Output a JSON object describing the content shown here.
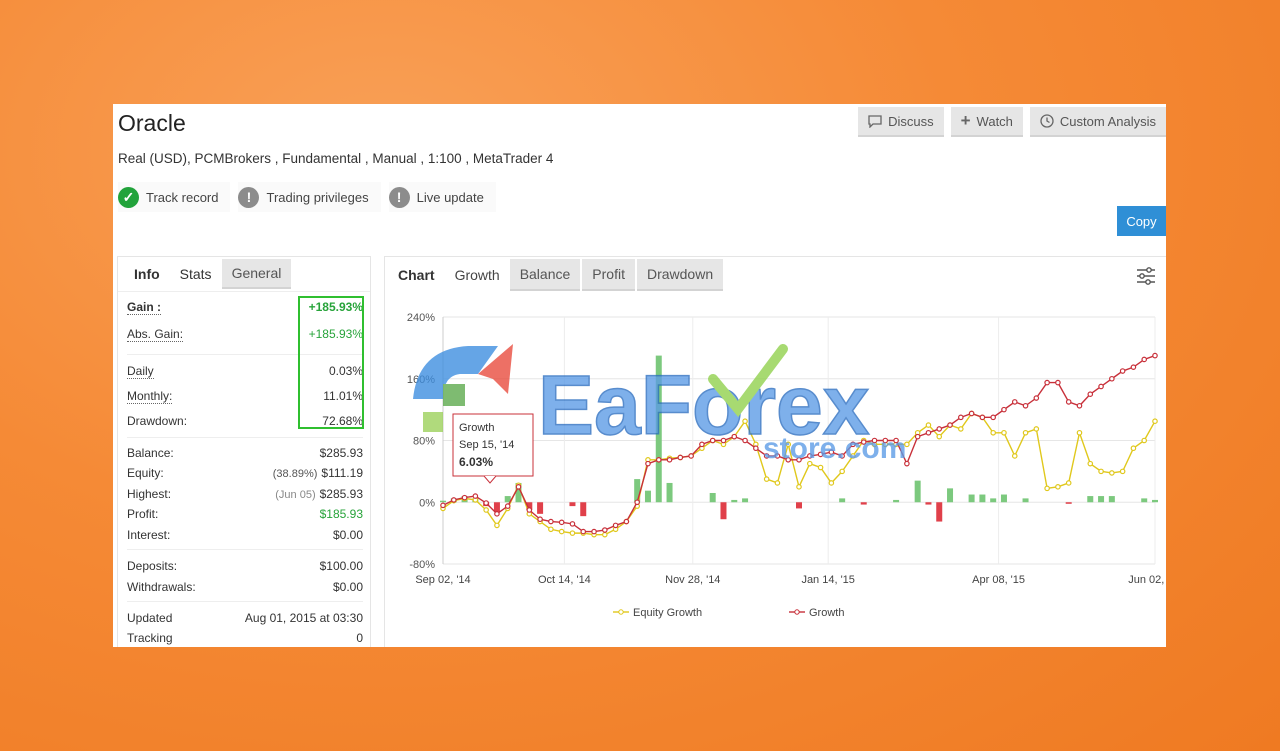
{
  "account": {
    "name": "Oracle",
    "details": "Real (USD), PCMBrokers , Fundamental , Manual , 1:100 , MetaTrader 4",
    "badges": [
      {
        "label": "Track record",
        "status": "ok",
        "icon": "check-icon"
      },
      {
        "label": "Trading privileges",
        "status": "unknown",
        "icon": "exclamation-icon"
      },
      {
        "label": "Live update",
        "status": "unknown",
        "icon": "exclamation-icon"
      }
    ]
  },
  "toolbar": {
    "discuss": "Discuss",
    "watch": "Watch",
    "custom_analysis": "Custom Analysis",
    "copy": "Copy"
  },
  "left_tabs": {
    "info": "Info",
    "stats": "Stats",
    "general": "General"
  },
  "stats": {
    "gain": {
      "label": "Gain :",
      "value": "+185.93%"
    },
    "abs_gain": {
      "label": "Abs. Gain:",
      "value": "+185.93%"
    },
    "daily": {
      "label": "Daily",
      "value": "0.03%"
    },
    "monthly": {
      "label": "Monthly:",
      "value": "11.01%"
    },
    "drawdown": {
      "label": "Drawdown:",
      "value": "72.68%"
    },
    "balance": {
      "label": "Balance:",
      "value": "$285.93"
    },
    "equity": {
      "label": "Equity:",
      "note": "(38.89%)",
      "value": "$111.19"
    },
    "highest": {
      "label": "Highest:",
      "note": "(Jun 05)",
      "value": "$285.93"
    },
    "profit": {
      "label": "Profit:",
      "value": "$185.93"
    },
    "interest": {
      "label": "Interest:",
      "value": "$0.00"
    },
    "deposits": {
      "label": "Deposits:",
      "value": "$100.00"
    },
    "withdrawals": {
      "label": "Withdrawals:",
      "value": "$0.00"
    },
    "updated": {
      "label": "Updated",
      "value": "Aug 01, 2015 at 03:30"
    },
    "tracking": {
      "label": "Tracking",
      "value": "0"
    }
  },
  "chart_tabs": {
    "chart": "Chart",
    "growth": "Growth",
    "balance": "Balance",
    "profit": "Profit",
    "drawdown": "Drawdown"
  },
  "watermark": {
    "brand": "EaForex",
    "sub": "store.com"
  },
  "tooltip": {
    "title": "Growth",
    "date": "Sep 15, '14",
    "value": "6.03%"
  },
  "colors": {
    "equity": "#e0c81c",
    "growth": "#c8303a",
    "bar_pos": "#7cc97e",
    "bar_neg": "#e0404a",
    "accent": "#2f8fd6"
  },
  "chart_data": {
    "type": "line",
    "ylim": [
      -80,
      240
    ],
    "yticks": [
      -80,
      0,
      80,
      160,
      240
    ],
    "ytick_labels": [
      "-80%",
      "0%",
      "80%",
      "160%",
      "240%"
    ],
    "xticks": [
      "Sep 02, '14",
      "Oct 14, '14",
      "Nov 28, '14",
      "Jan 14, '15",
      "Apr 08, '15",
      "Jun 02, '15"
    ],
    "legend_position": "bottom",
    "series": [
      {
        "name": "Equity Growth",
        "values": [
          -8,
          2,
          5,
          3,
          -10,
          -30,
          -8,
          22,
          -15,
          -25,
          -35,
          -38,
          -40,
          -40,
          -42,
          -42,
          -35,
          -25,
          -5,
          55,
          55,
          57,
          58,
          60,
          70,
          80,
          75,
          85,
          105,
          75,
          30,
          25,
          75,
          20,
          50,
          45,
          25,
          40,
          60,
          80,
          75,
          75,
          75,
          75,
          90,
          100,
          85,
          100,
          95,
          115,
          110,
          90,
          90,
          60,
          90,
          95,
          18,
          20,
          25,
          90,
          50,
          40,
          38,
          40,
          70,
          80,
          105
        ]
      },
      {
        "name": "Growth",
        "values": [
          -4,
          3,
          6,
          8,
          -1,
          -15,
          -5,
          20,
          -10,
          -22,
          -25,
          -26,
          -28,
          -38,
          -38,
          -36,
          -30,
          -25,
          0,
          50,
          55,
          55,
          58,
          60,
          75,
          80,
          80,
          85,
          80,
          70,
          60,
          60,
          55,
          55,
          60,
          62,
          65,
          60,
          75,
          78,
          80,
          80,
          80,
          50,
          85,
          90,
          95,
          100,
          110,
          115,
          110,
          110,
          120,
          130,
          125,
          135,
          155,
          155,
          130,
          125,
          140,
          150,
          160,
          170,
          175,
          185,
          190
        ]
      },
      {
        "name": "Profit",
        "values": [
          2,
          5,
          8,
          5,
          -5,
          -12,
          8,
          25,
          -10,
          -15,
          0,
          0,
          -5,
          -18,
          0,
          0,
          0,
          0,
          30,
          15,
          190,
          25,
          0,
          0,
          0,
          12,
          -22,
          3,
          5,
          0,
          0,
          0,
          0,
          -8,
          0,
          0,
          0,
          5,
          0,
          -3,
          0,
          0,
          3,
          0,
          28,
          -3,
          -25,
          18,
          0,
          10,
          10,
          5,
          10,
          0,
          5,
          0,
          0,
          0,
          -2,
          0,
          8,
          8,
          8,
          0,
          0,
          5,
          3
        ]
      }
    ]
  }
}
